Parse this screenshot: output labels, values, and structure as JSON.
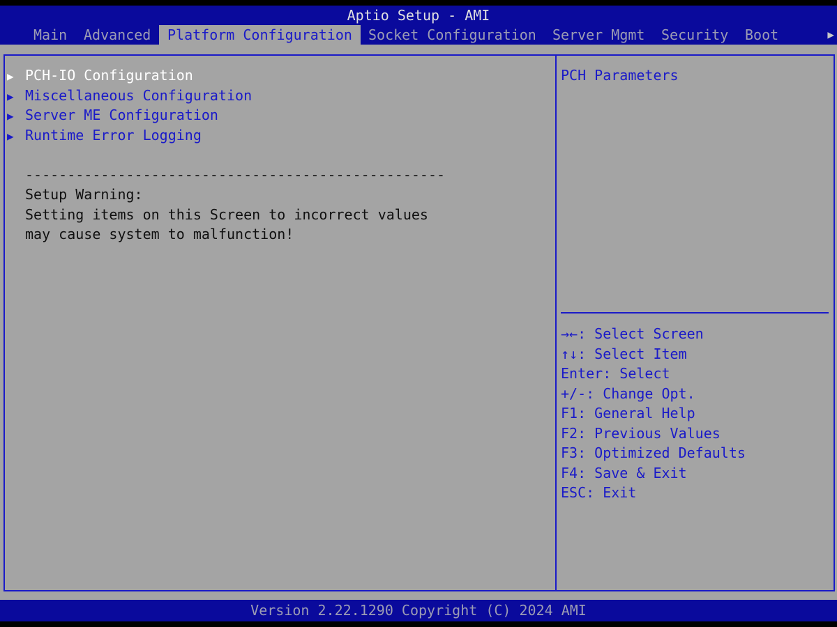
{
  "header": {
    "title": "Aptio Setup - AMI",
    "tabs": [
      {
        "label": "Main"
      },
      {
        "label": "Advanced"
      },
      {
        "label": "Platform Configuration",
        "active": true
      },
      {
        "label": "Socket Configuration"
      },
      {
        "label": "Server Mgmt"
      },
      {
        "label": "Security"
      },
      {
        "label": "Boot"
      }
    ],
    "more_arrow_icon": "triangle-right-icon"
  },
  "menu": {
    "items": [
      {
        "label": "PCH-IO Configuration",
        "selected": true
      },
      {
        "label": "Miscellaneous Configuration"
      },
      {
        "label": "Server ME Configuration"
      },
      {
        "label": "Runtime Error Logging"
      }
    ],
    "separator": "--------------------------------------------------",
    "warning_title": "Setup Warning:",
    "warning_line1": "Setting items on this Screen to incorrect values",
    "warning_line2": "may cause system to malfunction!"
  },
  "help": {
    "text": "PCH Parameters",
    "keys": [
      "→←: Select Screen",
      "↑↓: Select Item",
      "Enter: Select",
      "+/-: Change Opt.",
      "F1: General Help",
      "F2: Previous Values",
      "F3: Optimized Defaults",
      "F4: Save & Exit",
      "ESC: Exit"
    ]
  },
  "footer": {
    "text": "Version 2.22.1290 Copyright (C) 2024 AMI"
  },
  "colors": {
    "header_bg": "#0a0a9c",
    "panel_bg": "#a4a4a4",
    "accent_blue": "#1a1ac8",
    "selected_text": "#ffffff"
  }
}
